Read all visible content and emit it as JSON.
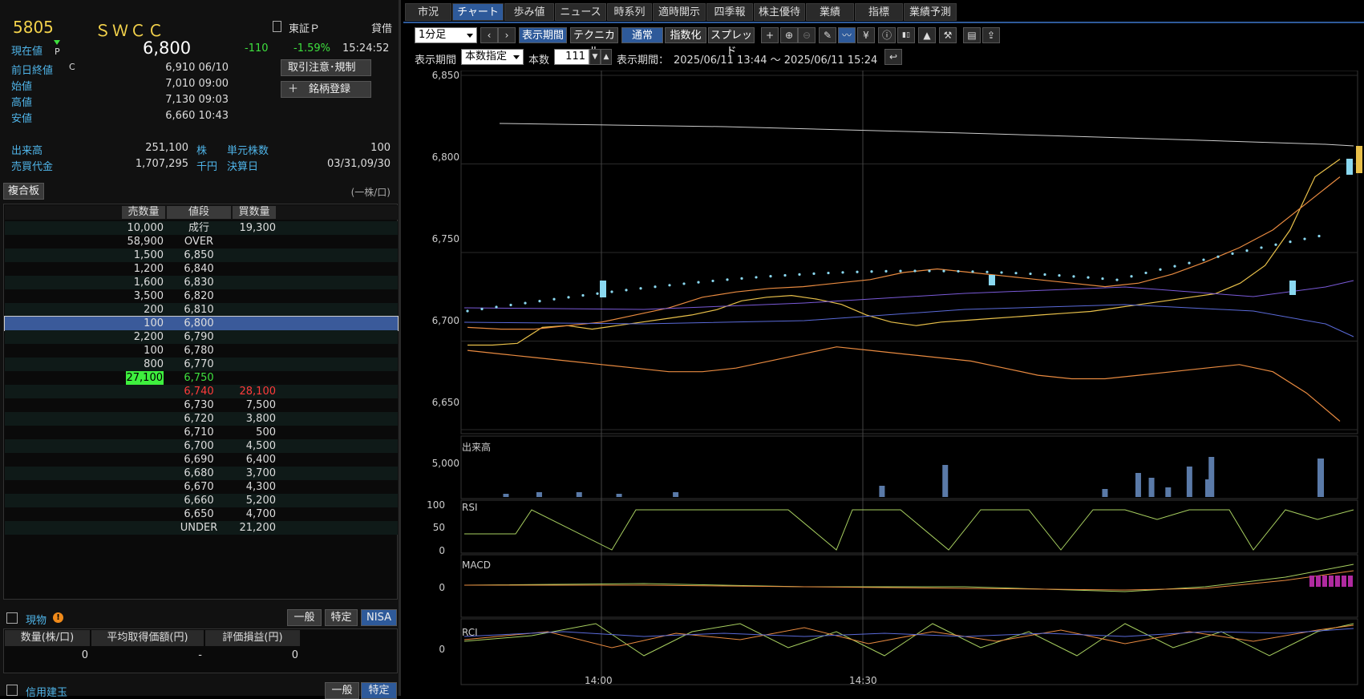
{
  "stock": {
    "code": "5805",
    "name": "ＳＷＣＣ",
    "market": "東証Ｐ",
    "tag": "貸借",
    "current_label": "現在値",
    "p_mark": "P",
    "current_price": "6,800",
    "change": "-110",
    "change_pct": "-1.59%",
    "time": "15:24:52",
    "prev_close_label": "前日終値",
    "prev_close_flag": "C",
    "prev_close": "6,910 06/10",
    "open_label": "始値",
    "open": "7,010 09:00",
    "high_label": "高値",
    "high": "7,130 09:03",
    "low_label": "安値",
    "low": "6,660 10:43",
    "volume_label": "出来高",
    "volume": "251,100",
    "volume_unit": "株",
    "unit_label": "単元株数",
    "unit": "100",
    "turnover_label": "売買代金",
    "turnover": "1,707,295",
    "turnover_unit": "千円",
    "settle_label": "決算日",
    "settle": "03/31,09/30",
    "btn_notice": "取引注意･規制",
    "btn_register": "＋　銘柄登録"
  },
  "orderbook": {
    "title": "複合板",
    "unit_note": "(一株/口)",
    "headers": [
      "売数量",
      "値段",
      "買数量"
    ],
    "rows": [
      {
        "sell": "10,000",
        "price": "成行",
        "buy": "19,300"
      },
      {
        "sell": "58,900",
        "price": "OVER",
        "buy": ""
      },
      {
        "sell": "1,500",
        "price": "6,850",
        "buy": ""
      },
      {
        "sell": "1,200",
        "price": "6,840",
        "buy": ""
      },
      {
        "sell": "1,600",
        "price": "6,830",
        "buy": ""
      },
      {
        "sell": "3,500",
        "price": "6,820",
        "buy": ""
      },
      {
        "sell": "200",
        "price": "6,810",
        "buy": ""
      },
      {
        "sell": "100",
        "price": "6,800",
        "buy": ""
      },
      {
        "sell": "2,200",
        "price": "6,790",
        "buy": ""
      },
      {
        "sell": "100",
        "price": "6,780",
        "buy": ""
      },
      {
        "sell": "800",
        "price": "6,770",
        "buy": ""
      },
      {
        "sell": "27,100",
        "price": "6,750",
        "buy": ""
      },
      {
        "sell": "",
        "price": "6,740",
        "buy": "28,100"
      },
      {
        "sell": "",
        "price": "6,730",
        "buy": "7,500"
      },
      {
        "sell": "",
        "price": "6,720",
        "buy": "3,800"
      },
      {
        "sell": "",
        "price": "6,710",
        "buy": "500"
      },
      {
        "sell": "",
        "price": "6,700",
        "buy": "4,500"
      },
      {
        "sell": "",
        "price": "6,690",
        "buy": "6,400"
      },
      {
        "sell": "",
        "price": "6,680",
        "buy": "3,700"
      },
      {
        "sell": "",
        "price": "6,670",
        "buy": "4,300"
      },
      {
        "sell": "",
        "price": "6,660",
        "buy": "5,200"
      },
      {
        "sell": "",
        "price": "6,650",
        "buy": "4,700"
      },
      {
        "sell": "",
        "price": "UNDER",
        "buy": "21,200"
      }
    ]
  },
  "holdings": {
    "title": "現物",
    "tabs": [
      "一般",
      "特定",
      "NISA"
    ],
    "headers": [
      "数量(株/口)",
      "平均取得価額(円)",
      "評価損益(円)"
    ],
    "values": [
      "0",
      "-",
      "0"
    ]
  },
  "margin": {
    "title": "信用建玉",
    "tabs": [
      "一般",
      "特定"
    ]
  },
  "tabs": [
    "市況",
    "チャート",
    "歩み値",
    "ニュース",
    "時系列",
    "適時開示",
    "四季報",
    "株主優待",
    "業績",
    "指標",
    "業績予測"
  ],
  "toolbar": {
    "interval": "1分足",
    "btn_period": "表示期間",
    "btn_technical": "テクニカル",
    "btn_normal": "通常",
    "btn_index": "指数化",
    "btn_spread": "スプレッド",
    "period_label": "表示期間",
    "period_select": "本数指定",
    "count_label": "本数",
    "count": "111",
    "range_label": "表示期間：",
    "range": "2025/06/11 13:44 ～ 2025/06/11 15:24"
  },
  "chart_labels": {
    "volume": "出来高",
    "rsi": "RSI",
    "macd": "MACD",
    "rci": "RCI"
  },
  "chart_data": {
    "type": "line",
    "price_axis": {
      "ticks": [
        "6,850",
        "6,800",
        "6,750",
        "6,700",
        "6,650"
      ],
      "ylim": [
        6645,
        6850
      ]
    },
    "volume_axis": {
      "ticks": [
        "5,000"
      ]
    },
    "rsi_axis": {
      "ticks": [
        "100",
        "50",
        "0"
      ]
    },
    "macd_axis": {
      "ticks": [
        "0"
      ]
    },
    "rci_axis": {
      "ticks": [
        "0"
      ]
    },
    "x_ticks": [
      "14:00",
      "14:30"
    ],
    "series": [
      {
        "name": "close",
        "values": [
          6695,
          6695,
          6696,
          6705,
          6706,
          6704,
          6706,
          6708,
          6710,
          6712,
          6715,
          6720,
          6722,
          6723,
          6721,
          6718,
          6712,
          6708,
          6706,
          6708,
          6709,
          6710,
          6711,
          6712,
          6713,
          6714,
          6716,
          6718,
          6720,
          6722,
          6724,
          6730,
          6740,
          6760,
          6790,
          6800
        ]
      },
      {
        "name": "bb_upper",
        "values": [
          6705,
          6704,
          6704,
          6706,
          6708,
          6712,
          6716,
          6722,
          6725,
          6727,
          6728,
          6730,
          6732,
          6736,
          6738,
          6736,
          6734,
          6732,
          6730,
          6728,
          6730,
          6735,
          6742,
          6750,
          6760,
          6775,
          6790
        ]
      },
      {
        "name": "bb_lower",
        "values": [
          6692,
          6690,
          6688,
          6686,
          6684,
          6682,
          6680,
          6680,
          6682,
          6686,
          6690,
          6694,
          6692,
          6690,
          6688,
          6686,
          6682,
          6678,
          6676,
          6676,
          6678,
          6680,
          6682,
          6684,
          6680,
          6668,
          6652
        ]
      }
    ]
  }
}
